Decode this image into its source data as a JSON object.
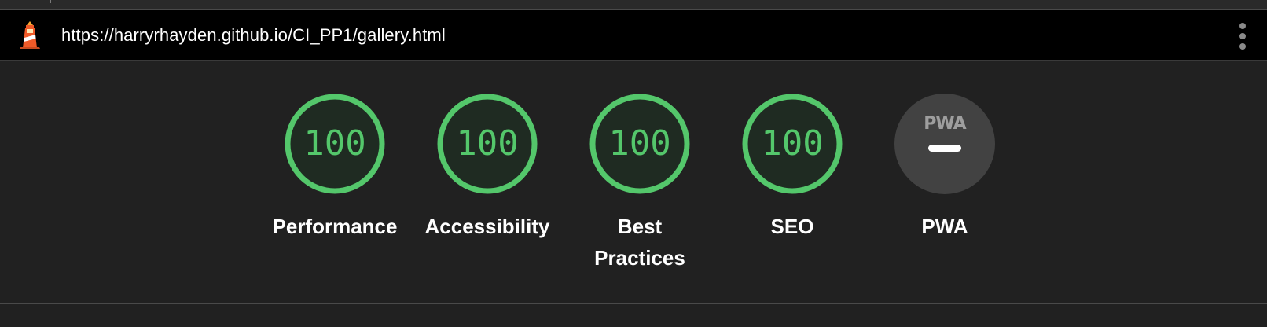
{
  "report": {
    "url": "https://harryrhayden.github.io/CI_PP1/gallery.html"
  },
  "colors": {
    "pass": "#54c76b",
    "pass_fill": "#1f2b22",
    "neutral": "#424242",
    "text": "#ffffff",
    "background": "#212121"
  },
  "categories": [
    {
      "label": "Performance",
      "score": "100",
      "status": "pass"
    },
    {
      "label": "Accessibility",
      "score": "100",
      "status": "pass"
    },
    {
      "label": "Best Practices",
      "score": "100",
      "status": "pass"
    },
    {
      "label": "SEO",
      "score": "100",
      "status": "pass"
    }
  ],
  "pwa": {
    "badge_text": "PWA",
    "label": "PWA",
    "score": "—"
  }
}
